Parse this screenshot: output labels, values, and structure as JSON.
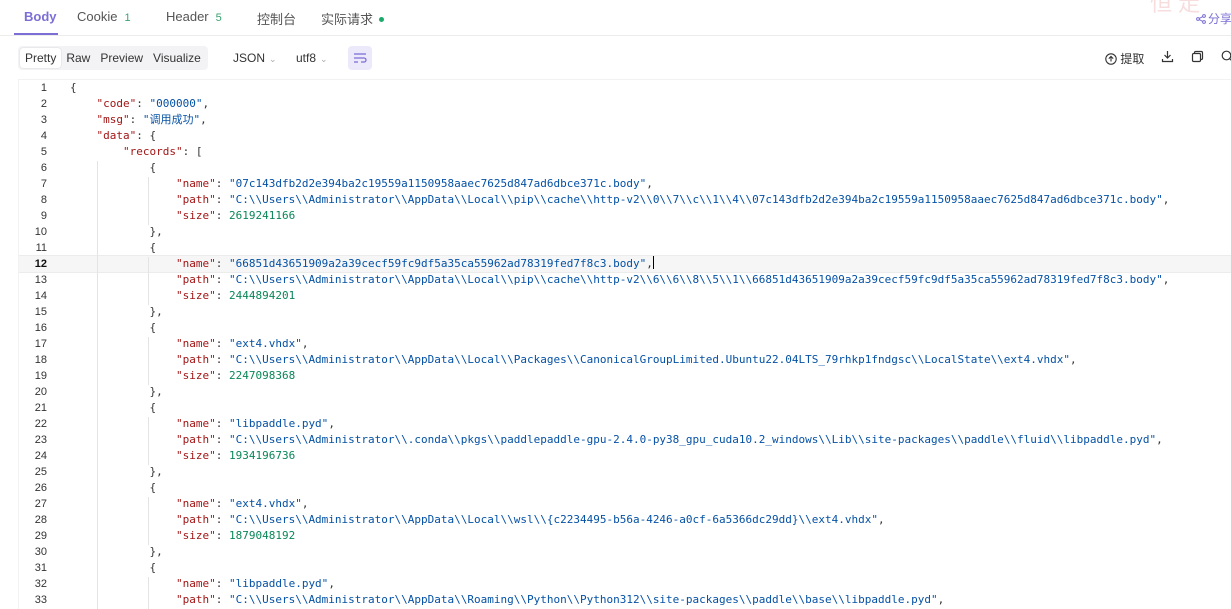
{
  "tabs": {
    "body": {
      "label": "Body"
    },
    "cookie": {
      "label": "Cookie",
      "count": "1"
    },
    "header": {
      "label": "Header",
      "count": "5"
    },
    "console": {
      "label": "控制台"
    },
    "actual": {
      "label": "实际请求"
    }
  },
  "share": {
    "label": "分享"
  },
  "toolbar": {
    "views": [
      "Pretty",
      "Raw",
      "Preview",
      "Visualize"
    ],
    "format": "JSON",
    "encoding": "utf8",
    "extract_label": "提取"
  },
  "editor": {
    "current_line": 12,
    "lines": [
      [
        [
          "p",
          "{"
        ]
      ],
      [
        [
          "p",
          "    "
        ],
        [
          "k",
          "\"code\""
        ],
        [
          "p",
          ": "
        ],
        [
          "s",
          "\"000000\""
        ],
        [
          "p",
          ","
        ]
      ],
      [
        [
          "p",
          "    "
        ],
        [
          "k",
          "\"msg\""
        ],
        [
          "p",
          ": "
        ],
        [
          "s",
          "\"调用成功\""
        ],
        [
          "p",
          ","
        ]
      ],
      [
        [
          "p",
          "    "
        ],
        [
          "k",
          "\"data\""
        ],
        [
          "p",
          ": {"
        ]
      ],
      [
        [
          "p",
          "        "
        ],
        [
          "k",
          "\"records\""
        ],
        [
          "p",
          ": ["
        ]
      ],
      [
        [
          "p",
          "            {"
        ]
      ],
      [
        [
          "p",
          "                "
        ],
        [
          "k",
          "\"name\""
        ],
        [
          "p",
          ": "
        ],
        [
          "s",
          "\"07c143dfb2d2e394ba2c19559a1150958aaec7625d847ad6dbce371c.body\""
        ],
        [
          "p",
          ","
        ]
      ],
      [
        [
          "p",
          "                "
        ],
        [
          "k",
          "\"path\""
        ],
        [
          "p",
          ": "
        ],
        [
          "s",
          "\"C:\\\\Users\\\\Administrator\\\\AppData\\\\Local\\\\pip\\\\cache\\\\http-v2\\\\0\\\\7\\\\c\\\\1\\\\4\\\\07c143dfb2d2e394ba2c19559a1150958aaec7625d847ad6dbce371c.body\""
        ],
        [
          "p",
          ","
        ]
      ],
      [
        [
          "p",
          "                "
        ],
        [
          "k",
          "\"size\""
        ],
        [
          "p",
          ": "
        ],
        [
          "n",
          "2619241166"
        ]
      ],
      [
        [
          "p",
          "            },"
        ]
      ],
      [
        [
          "p",
          "            {"
        ]
      ],
      [
        [
          "p",
          "                "
        ],
        [
          "k",
          "\"name\""
        ],
        [
          "p",
          ": "
        ],
        [
          "s",
          "\"66851d43651909a2a39cecf59fc9df5a35ca55962ad78319fed7f8c3.body\""
        ],
        [
          "p",
          ","
        ],
        [
          "c",
          ""
        ]
      ],
      [
        [
          "p",
          "                "
        ],
        [
          "k",
          "\"path\""
        ],
        [
          "p",
          ": "
        ],
        [
          "s",
          "\"C:\\\\Users\\\\Administrator\\\\AppData\\\\Local\\\\pip\\\\cache\\\\http-v2\\\\6\\\\6\\\\8\\\\5\\\\1\\\\66851d43651909a2a39cecf59fc9df5a35ca55962ad78319fed7f8c3.body\""
        ],
        [
          "p",
          ","
        ]
      ],
      [
        [
          "p",
          "                "
        ],
        [
          "k",
          "\"size\""
        ],
        [
          "p",
          ": "
        ],
        [
          "n",
          "2444894201"
        ]
      ],
      [
        [
          "p",
          "            },"
        ]
      ],
      [
        [
          "p",
          "            {"
        ]
      ],
      [
        [
          "p",
          "                "
        ],
        [
          "k",
          "\"name\""
        ],
        [
          "p",
          ": "
        ],
        [
          "s",
          "\"ext4.vhdx\""
        ],
        [
          "p",
          ","
        ]
      ],
      [
        [
          "p",
          "                "
        ],
        [
          "k",
          "\"path\""
        ],
        [
          "p",
          ": "
        ],
        [
          "s",
          "\"C:\\\\Users\\\\Administrator\\\\AppData\\\\Local\\\\Packages\\\\CanonicalGroupLimited.Ubuntu22.04LTS_79rhkp1fndgsc\\\\LocalState\\\\ext4.vhdx\""
        ],
        [
          "p",
          ","
        ]
      ],
      [
        [
          "p",
          "                "
        ],
        [
          "k",
          "\"size\""
        ],
        [
          "p",
          ": "
        ],
        [
          "n",
          "2247098368"
        ]
      ],
      [
        [
          "p",
          "            },"
        ]
      ],
      [
        [
          "p",
          "            {"
        ]
      ],
      [
        [
          "p",
          "                "
        ],
        [
          "k",
          "\"name\""
        ],
        [
          "p",
          ": "
        ],
        [
          "s",
          "\"libpaddle.pyd\""
        ],
        [
          "p",
          ","
        ]
      ],
      [
        [
          "p",
          "                "
        ],
        [
          "k",
          "\"path\""
        ],
        [
          "p",
          ": "
        ],
        [
          "s",
          "\"C:\\\\Users\\\\Administrator\\\\.conda\\\\pkgs\\\\paddlepaddle-gpu-2.4.0-py38_gpu_cuda10.2_windows\\\\Lib\\\\site-packages\\\\paddle\\\\fluid\\\\libpaddle.pyd\""
        ],
        [
          "p",
          ","
        ]
      ],
      [
        [
          "p",
          "                "
        ],
        [
          "k",
          "\"size\""
        ],
        [
          "p",
          ": "
        ],
        [
          "n",
          "1934196736"
        ]
      ],
      [
        [
          "p",
          "            },"
        ]
      ],
      [
        [
          "p",
          "            {"
        ]
      ],
      [
        [
          "p",
          "                "
        ],
        [
          "k",
          "\"name\""
        ],
        [
          "p",
          ": "
        ],
        [
          "s",
          "\"ext4.vhdx\""
        ],
        [
          "p",
          ","
        ]
      ],
      [
        [
          "p",
          "                "
        ],
        [
          "k",
          "\"path\""
        ],
        [
          "p",
          ": "
        ],
        [
          "s",
          "\"C:\\\\Users\\\\Administrator\\\\AppData\\\\Local\\\\wsl\\\\{c2234495-b56a-4246-a0cf-6a5366dc29dd}\\\\ext4.vhdx\""
        ],
        [
          "p",
          ","
        ]
      ],
      [
        [
          "p",
          "                "
        ],
        [
          "k",
          "\"size\""
        ],
        [
          "p",
          ": "
        ],
        [
          "n",
          "1879048192"
        ]
      ],
      [
        [
          "p",
          "            },"
        ]
      ],
      [
        [
          "p",
          "            {"
        ]
      ],
      [
        [
          "p",
          "                "
        ],
        [
          "k",
          "\"name\""
        ],
        [
          "p",
          ": "
        ],
        [
          "s",
          "\"libpaddle.pyd\""
        ],
        [
          "p",
          ","
        ]
      ],
      [
        [
          "p",
          "                "
        ],
        [
          "k",
          "\"path\""
        ],
        [
          "p",
          ": "
        ],
        [
          "s",
          "\"C:\\\\Users\\\\Administrator\\\\AppData\\\\Roaming\\\\Python\\\\Python312\\\\site-packages\\\\paddle\\\\base\\\\libpaddle.pyd\""
        ],
        [
          "p",
          ","
        ]
      ]
    ]
  },
  "colors": {
    "accent": "#7b6fd6",
    "count": "#3ba16f",
    "json_key": "#a31515",
    "json_string": "#0451a5",
    "json_number": "#098658"
  }
}
